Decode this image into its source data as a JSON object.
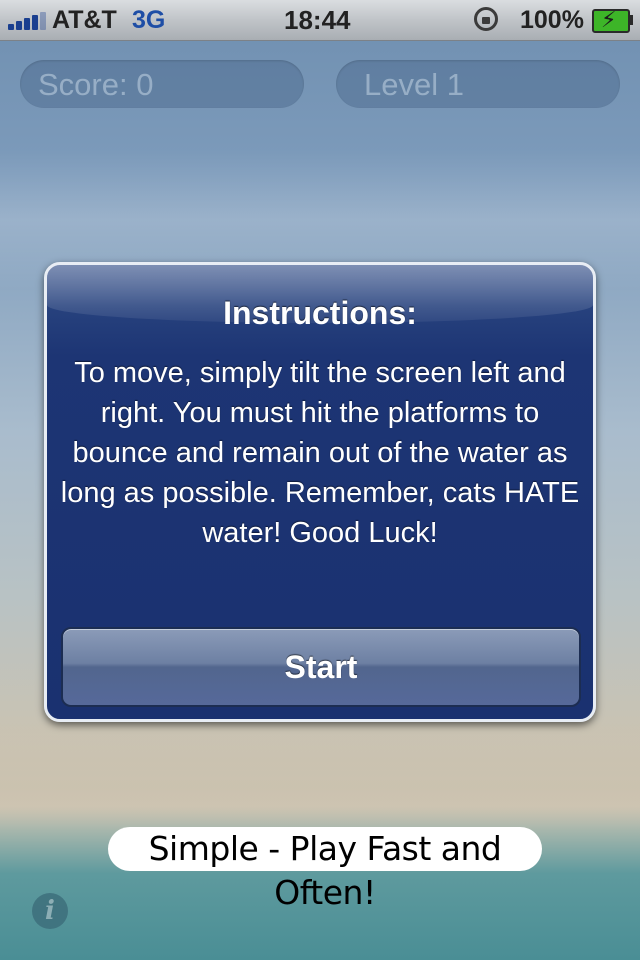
{
  "status_bar": {
    "carrier": "AT&T",
    "network": "3G",
    "time": "18:44",
    "battery_percent": "100%",
    "icons": [
      "signal-bars-icon",
      "rotation-lock-icon",
      "battery-charging-icon"
    ]
  },
  "hud": {
    "score_label": "Score: 0",
    "level_label": "Level 1"
  },
  "dialog": {
    "title": "Instructions:",
    "message": "To move, simply tilt the screen left and right.  You must hit the platforms to bounce and remain out of the water as long as possible.  Remember, cats HATE water!  Good Luck!",
    "start_label": "Start"
  },
  "footer": {
    "tagline": "Simple - Play Fast and Often!",
    "info_icon": "info-icon"
  },
  "colors": {
    "dialog_background": "#1a3170",
    "signal_blue": "#1a3f8f",
    "battery_green": "#3db528"
  }
}
